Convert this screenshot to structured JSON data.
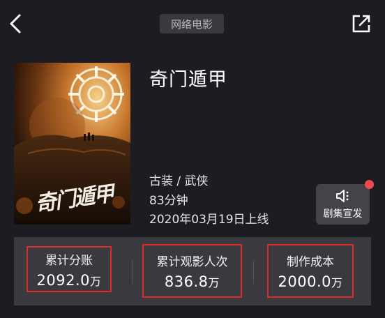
{
  "header": {
    "tag": "网络电影",
    "back_icon": "chevron-left-icon",
    "share_icon": "external-share-icon"
  },
  "movie": {
    "title": "奇门遁甲",
    "poster_title": "奇门遁甲",
    "genre": "古装 / 武侠",
    "duration": "83分钟",
    "release": "2020年03月19日上线"
  },
  "promo": {
    "label": "剧集宣发",
    "icon": "speaker-icon",
    "badge_color": "#f04a4a"
  },
  "stats": [
    {
      "label": "累计分账",
      "value": "2092.0",
      "unit": "万"
    },
    {
      "label": "累计观影人次",
      "value": "836.8",
      "unit": "万"
    },
    {
      "label": "制作成本",
      "value": "2000.0",
      "unit": "万"
    }
  ],
  "colors": {
    "background": "#1d1c22",
    "panel": "#3a3940",
    "highlight_border": "#e02a2a"
  }
}
